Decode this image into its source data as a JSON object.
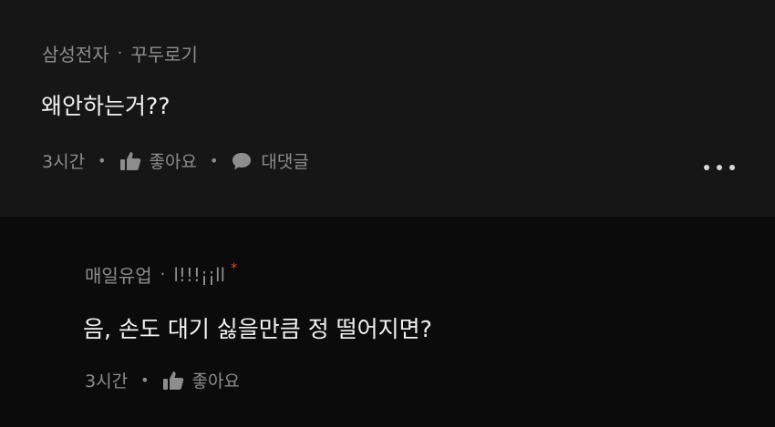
{
  "comment": {
    "author": "삼성전자",
    "separator": "·",
    "nickname": "꾸두로기",
    "text": "왜안하는거??",
    "time": "3시간",
    "like_label": "좋아요",
    "reply_label": "대댓글",
    "more_icon": "more-horizontal-icon"
  },
  "reply": {
    "author": "매일유업",
    "separator": "·",
    "nickname": "l!!!¡¡ll",
    "badge": "*",
    "text": "음,  손도 대기 싫을만큼 정 떨어지면?",
    "time": "3시간",
    "like_label": "좋아요"
  },
  "colors": {
    "background": "#0b0b0b",
    "comment_background": "#161616",
    "meta_text": "#8d8d8d",
    "body_text": "#f2f2f2",
    "badge": "#e0453a"
  },
  "icons": {
    "like": "thumbs-up-icon",
    "reply": "speech-bubble-icon",
    "more": "more-dots-icon"
  }
}
